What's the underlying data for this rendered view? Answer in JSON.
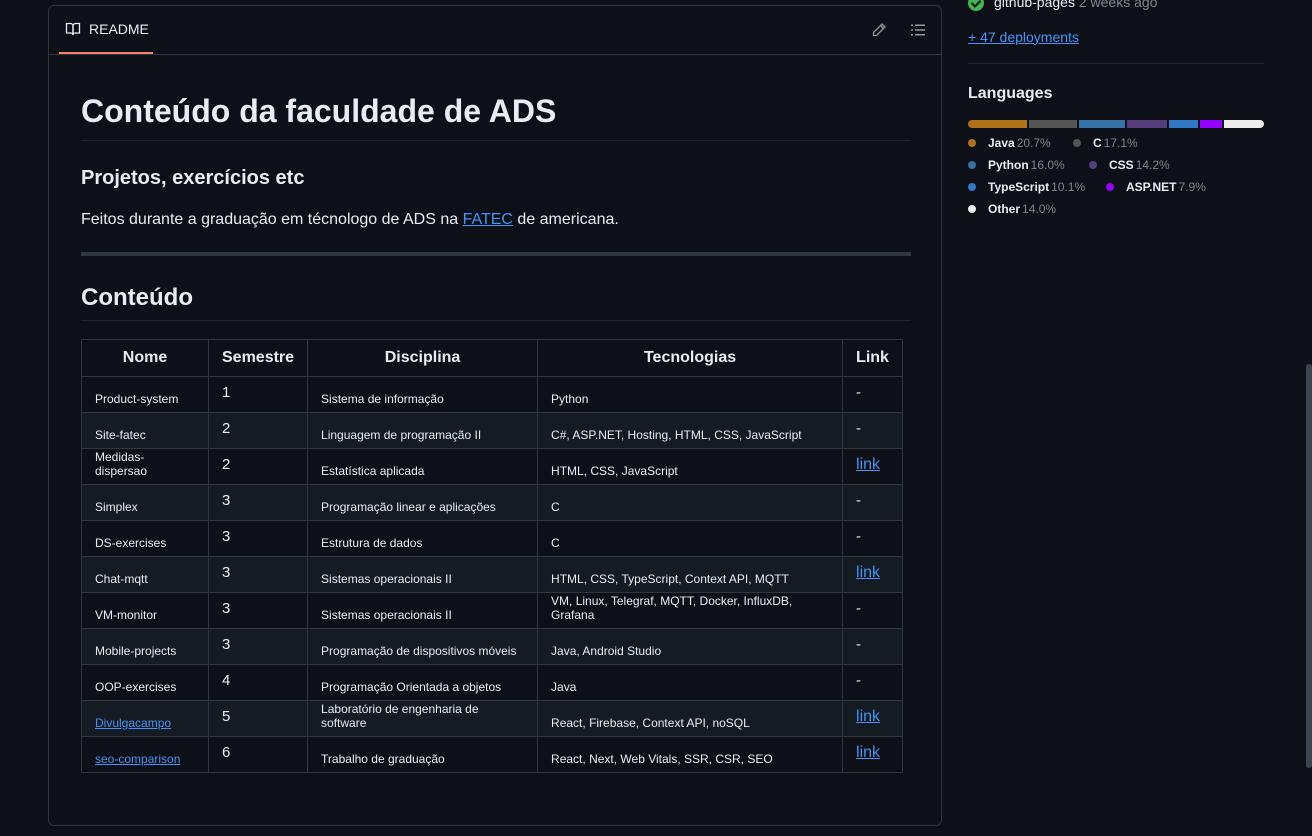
{
  "readme": {
    "tab_label": "README",
    "title": "Conteúdo da faculdade de ADS",
    "subtitle": "Projetos, exercícios etc",
    "desc_before": "Feitos durante a graduação em técnologo de ADS na ",
    "desc_link": "FATEC",
    "desc_after": " de americana.",
    "section_title": "Conteúdo",
    "table": {
      "headers": [
        "Nome",
        "Semestre",
        "Disciplina",
        "Tecnologias",
        "Link"
      ],
      "rows": [
        {
          "nome": "Product-system",
          "semestre": "1",
          "disciplina": "Sistema de informação",
          "tecnologias": "Python",
          "link": "-"
        },
        {
          "nome": "Site-fatec",
          "semestre": "2",
          "disciplina": "Linguagem de programação II",
          "tecnologias": "C#, ASP.NET, Hosting, HTML, CSS, JavaScript",
          "link": "-"
        },
        {
          "nome": "Medidas-dispersao",
          "semestre": "2",
          "disciplina": "Estatística aplicada",
          "tecnologias": "HTML, CSS, JavaScript",
          "link": "link"
        },
        {
          "nome": "Simplex",
          "semestre": "3",
          "disciplina": "Programação linear e aplicações",
          "tecnologias": "C",
          "link": "-"
        },
        {
          "nome": "DS-exercises",
          "semestre": "3",
          "disciplina": "Estrutura de dados",
          "tecnologias": "C",
          "link": "-"
        },
        {
          "nome": "Chat-mqtt",
          "semestre": "3",
          "disciplina": "Sistemas operacionais II",
          "tecnologias": "HTML, CSS, TypeScript, Context API, MQTT",
          "link": "link"
        },
        {
          "nome": "VM-monitor",
          "semestre": "3",
          "disciplina": "Sistemas operacionais II",
          "tecnologias": "VM, Linux, Telegraf, MQTT, Docker, InfluxDB, Grafana",
          "link": "-"
        },
        {
          "nome": "Mobile-projects",
          "semestre": "3",
          "disciplina": "Programação de dispositivos móveis",
          "tecnologias": "Java, Android Studio",
          "link": "-"
        },
        {
          "nome": "OOP-exercises",
          "semestre": "4",
          "disciplina": "Programação Orientada a objetos",
          "tecnologias": "Java",
          "link": "-"
        },
        {
          "nome": "Divulgacampo",
          "nome_is_link": true,
          "semestre": "5",
          "disciplina": "Laboratório de engenharia de software",
          "tecnologias": "React, Firebase, Context API, noSQL",
          "link": "link"
        },
        {
          "nome": "seo-comparison",
          "nome_is_link": true,
          "semestre": "6",
          "disciplina": "Trabalho de graduação",
          "tecnologias": "React, Next, Web Vitals, SSR, CSR, SEO",
          "link": "link"
        }
      ]
    }
  },
  "sidebar": {
    "deployment_name": "github-pages",
    "deployment_time": "2 weeks ago",
    "more_deployments": "+ 47 deployments",
    "languages_title": "Languages",
    "languages": [
      {
        "name": "Java",
        "pct": "20.7%",
        "value": 20.7,
        "color": "#b07219"
      },
      {
        "name": "C",
        "pct": "17.1%",
        "value": 17.1,
        "color": "#555555"
      },
      {
        "name": "Python",
        "pct": "16.0%",
        "value": 16.0,
        "color": "#3572A5"
      },
      {
        "name": "CSS",
        "pct": "14.2%",
        "value": 14.2,
        "color": "#563d7c"
      },
      {
        "name": "TypeScript",
        "pct": "10.1%",
        "value": 10.1,
        "color": "#3178c6"
      },
      {
        "name": "ASP.NET",
        "pct": "7.9%",
        "value": 7.9,
        "color": "#9400ff"
      },
      {
        "name": "Other",
        "pct": "14.0%",
        "value": 14.0,
        "color": "#ededed"
      }
    ]
  },
  "icons": {
    "readme_tab": "book-icon",
    "edit": "pencil-icon",
    "outline": "list-unordered-icon",
    "deploy_status": "check-circle-icon"
  }
}
